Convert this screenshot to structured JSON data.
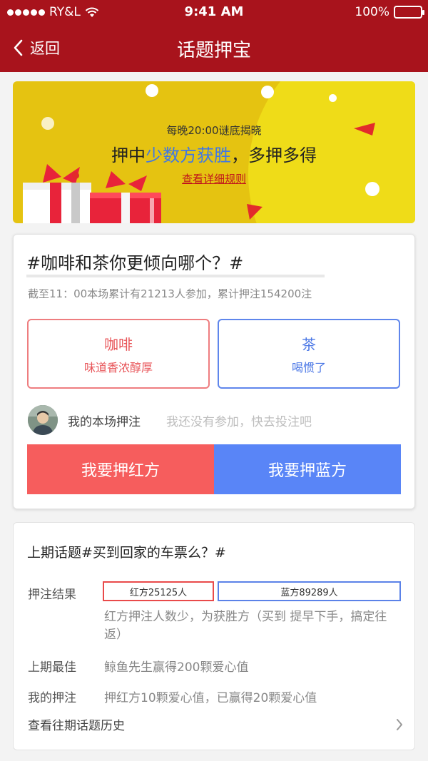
{
  "status_bar": {
    "carrier": "RY&L",
    "time": "9:41 AM",
    "battery": "100%"
  },
  "nav": {
    "back_label": "返回",
    "title": "话题押宝"
  },
  "banner": {
    "line1": "每晚20:00谜底揭晓",
    "line2_prefix": "押中",
    "line2_highlight": "少数方获胜",
    "line2_suffix": "，多押多得",
    "rules_link": "查看详细规则"
  },
  "topic": {
    "title": "#咖啡和茶你更倾向哪个？#",
    "stats": "截至11：00本场累计有21213人参加，累计押注154200注",
    "options": [
      {
        "name": "咖啡",
        "desc": "味道香浓醇厚",
        "side": "red"
      },
      {
        "name": "茶",
        "desc": "喝惯了",
        "side": "blue"
      }
    ],
    "my_bet_label": "我的本场押注",
    "my_bet_hint": "我还没有参加，快去投注吧",
    "bet_red_label": "我要押红方",
    "bet_blue_label": "我要押蓝方"
  },
  "last_topic": {
    "title": "上期话题#买到回家的车票么？#",
    "result_label": "押注结果",
    "red_result": "红方25125人",
    "blue_result": "蓝方89289人",
    "result_desc": "红方押注人数少，为获胜方（买到 提早下手，搞定往返）",
    "best_label": "上期最佳",
    "best_value": "鲸鱼先生赢得200颗爱心值",
    "mine_label": "我的押注",
    "mine_value": "押红方10颗爱心值，已赢得20颗爱心值",
    "history_link": "查看往期话题历史"
  },
  "colors": {
    "nav_bg": "#a8131c",
    "banner_bg": "#e5c311",
    "red": "#f65d5d",
    "blue": "#5985f7"
  }
}
